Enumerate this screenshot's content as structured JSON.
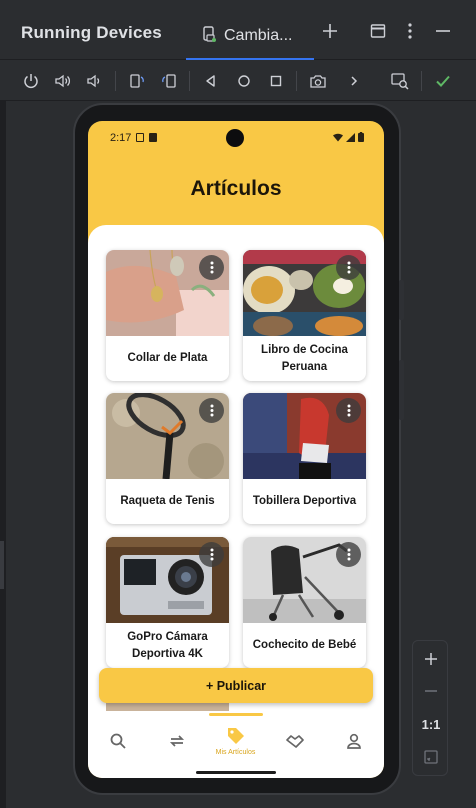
{
  "ide": {
    "title": "Running Devices",
    "tab": {
      "label": "Cambia..."
    },
    "toolbar_icons": [
      "power-icon",
      "volume-up-icon",
      "volume-down-icon",
      "rotate-left-icon",
      "rotate-right-icon",
      "back-icon",
      "home-icon",
      "overview-icon",
      "screenshot-icon",
      "more-chevron-icon",
      "device-explorer-icon",
      "check-icon"
    ],
    "zoom": {
      "one_to_one": "1:1"
    }
  },
  "phone": {
    "status_bar": {
      "time": "2:17"
    },
    "page_title": "Artículos",
    "cards": [
      {
        "title": "Collar de Plata"
      },
      {
        "title": "Libro de Cocina Peruana"
      },
      {
        "title": "Raqueta de Tenis"
      },
      {
        "title": "Tobillera Deportiva"
      },
      {
        "title": "GoPro Cámara Deportiva 4K"
      },
      {
        "title": "Cochecito de Bebé"
      }
    ],
    "publish_button": "+ Publicar",
    "nav": {
      "items": [
        "search-icon",
        "swap-icon",
        "tag-icon",
        "handshake-icon",
        "person-icon"
      ],
      "active_label": "Mis Artículos"
    }
  },
  "colors": {
    "accent": "#f9c845",
    "ide_bg": "#2b2d30",
    "tab_underline": "#3574f0",
    "check": "#5fb865"
  }
}
